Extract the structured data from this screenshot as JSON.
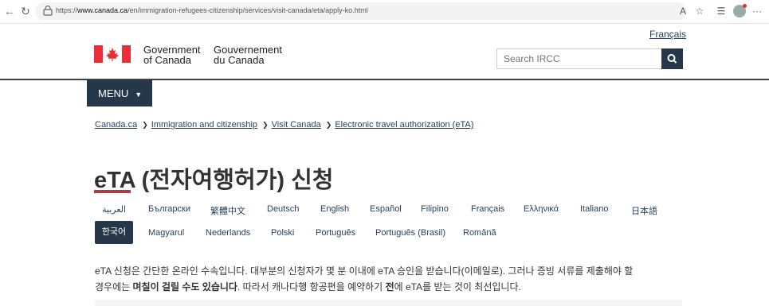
{
  "browser": {
    "url_prefix": "https://",
    "url_domain": "www.canada.ca",
    "url_path": "/en/immigration-refugees-citizenship/services/visit-canada/eta/apply-ko.html"
  },
  "header": {
    "language_toggle": "Français",
    "signature_en_line1": "Government",
    "signature_en_line2": "of Canada",
    "signature_fr_line1": "Gouvernement",
    "signature_fr_line2": "du Canada",
    "search_placeholder": "Search IRCC",
    "menu_label": "MENU"
  },
  "breadcrumb": [
    "Canada.ca",
    "Immigration and citizenship",
    "Visit Canada",
    "Electronic travel authorization (eTA)"
  ],
  "page_title": "eTA (전자여행허가) 신청",
  "languages_row1": [
    "العربية",
    "Български",
    "繁體中文",
    "Deutsch",
    "English",
    "Español",
    "Filipino",
    "Français",
    "Ελληνικά",
    "Italiano",
    "日本語"
  ],
  "languages_row2_active": "한국어",
  "languages_row2": [
    "Magyarul",
    "Nederlands",
    "Polski",
    "Português",
    "Português (Brasil)",
    "Română"
  ],
  "body": {
    "line1": "eTA 신청은 간단한 온라인 수속입니다. 대부분의 신청자가 몇 분 이내에 eTA 승인을 받습니다(이메일로). 그러나 증빙 서류를 제출해야 할",
    "line2_a": "경우에는 ",
    "line2_b": "며칠이 걸릴 수도 있습니다",
    "line2_c": ". 따라서 캐나다행 항공편을 예약하기 ",
    "line2_d": "전",
    "line2_e": "에 eTA를 받는 것이 최선입니다."
  },
  "colors": {
    "primary": "#26374a",
    "link": "#284162",
    "accent_red": "#af3c43",
    "flag_red": "#eb2d37"
  }
}
